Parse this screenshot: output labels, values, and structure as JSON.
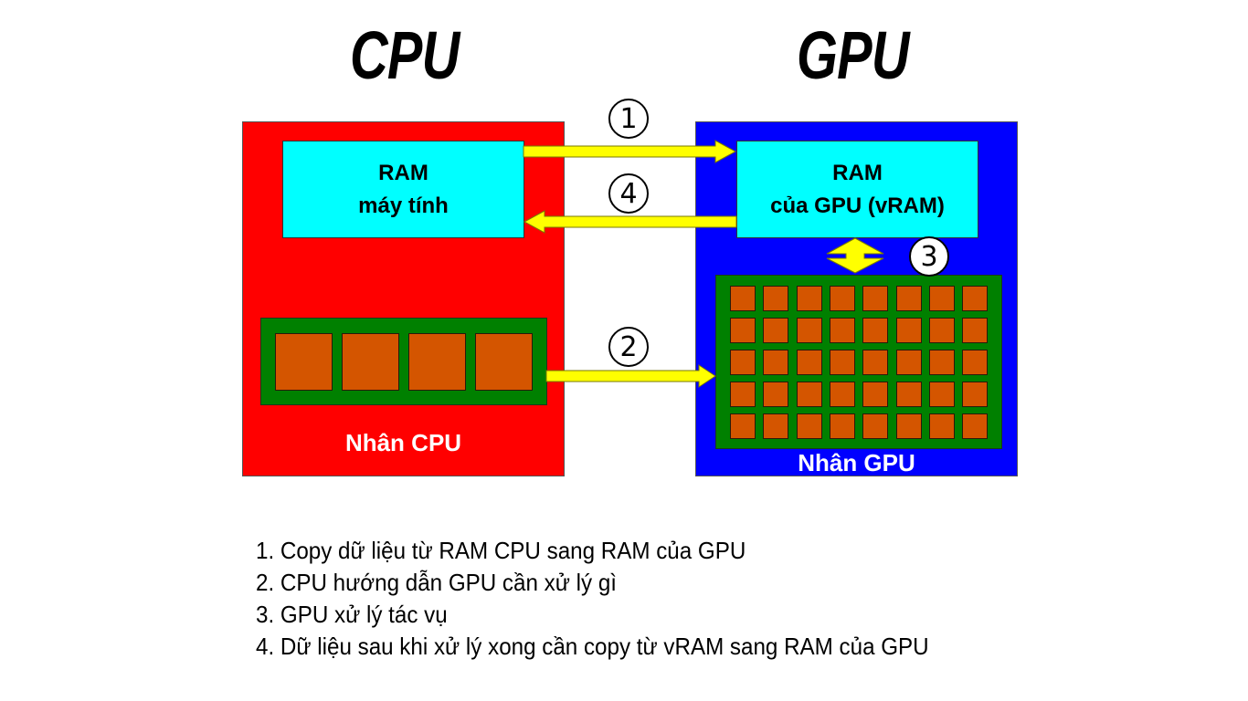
{
  "titles": {
    "cpu": "CPU",
    "gpu": "GPU"
  },
  "colors": {
    "cpu_panel": "#ff0000",
    "gpu_panel": "#0000ff",
    "ram": "#00ffff",
    "core_board": "#008000",
    "core": "#d45500",
    "arrow": "#ffff00"
  },
  "cpu": {
    "ram_line1": "RAM",
    "ram_line2": "máy tính",
    "core_label": "Nhân CPU",
    "core_count": 4
  },
  "gpu": {
    "ram_line1": "RAM",
    "ram_line2": "của GPU (vRAM)",
    "core_label": "Nhân GPU",
    "core_rows": 5,
    "core_cols": 8
  },
  "badges": [
    "1",
    "2",
    "3",
    "4"
  ],
  "steps": [
    "1. Copy dữ liệu từ RAM CPU sang RAM của GPU",
    "2. CPU hướng dẫn GPU cần xử lý gì",
    "3. GPU xử lý tác vụ",
    "4. Dữ liệu sau khi xử lý xong cần copy từ vRAM sang RAM của GPU"
  ]
}
